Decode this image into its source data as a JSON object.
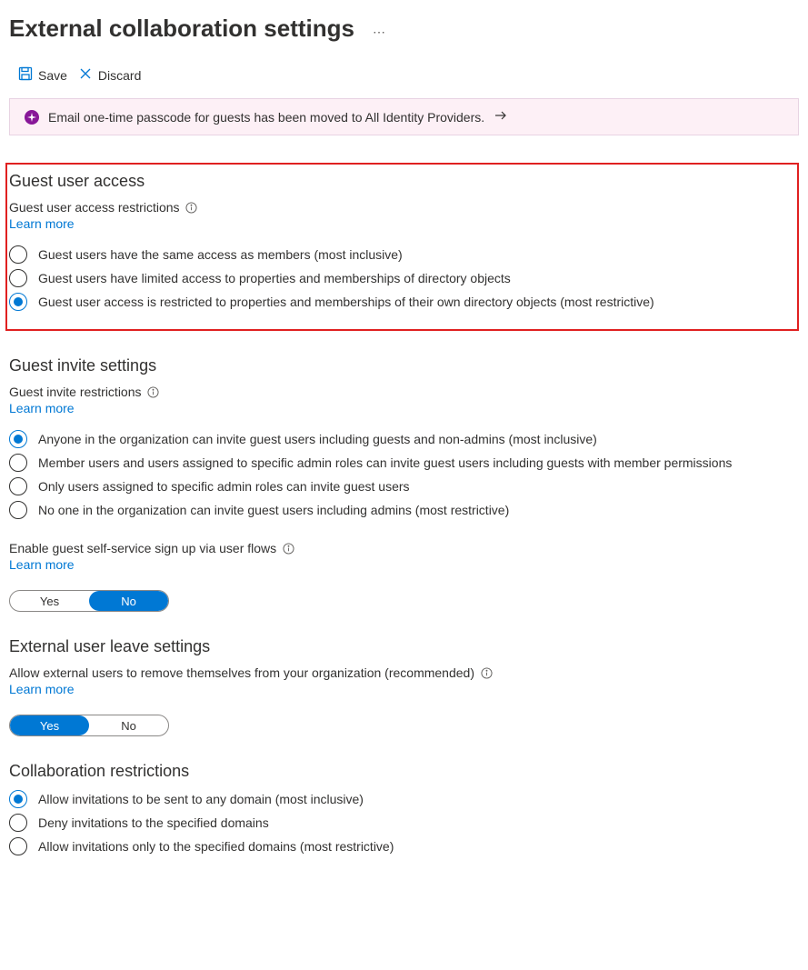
{
  "page": {
    "title": "External collaboration settings"
  },
  "toolbar": {
    "save": "Save",
    "discard": "Discard"
  },
  "banner": {
    "text": "Email one-time passcode for guests has been moved to All Identity Providers."
  },
  "learn_more": "Learn more",
  "toggle": {
    "yes": "Yes",
    "no": "No"
  },
  "guest_access": {
    "heading": "Guest user access",
    "label": "Guest user access restrictions",
    "options": [
      "Guest users have the same access as members (most inclusive)",
      "Guest users have limited access to properties and memberships of directory objects",
      "Guest user access is restricted to properties and memberships of their own directory objects (most restrictive)"
    ],
    "selected_index": 2
  },
  "guest_invite": {
    "heading": "Guest invite settings",
    "label": "Guest invite restrictions",
    "options": [
      "Anyone in the organization can invite guest users including guests and non-admins (most inclusive)",
      "Member users and users assigned to specific admin roles can invite guest users including guests with member permissions",
      "Only users assigned to specific admin roles can invite guest users",
      "No one in the organization can invite guest users including admins (most restrictive)"
    ],
    "selected_index": 0,
    "self_service_label": "Enable guest self-service sign up via user flows",
    "self_service_value": "No"
  },
  "external_leave": {
    "heading": "External user leave settings",
    "label": "Allow external users to remove themselves from your organization (recommended)",
    "value": "Yes"
  },
  "collab_restrict": {
    "heading": "Collaboration restrictions",
    "options": [
      "Allow invitations to be sent to any domain (most inclusive)",
      "Deny invitations to the specified domains",
      "Allow invitations only to the specified domains (most restrictive)"
    ],
    "selected_index": 0
  }
}
